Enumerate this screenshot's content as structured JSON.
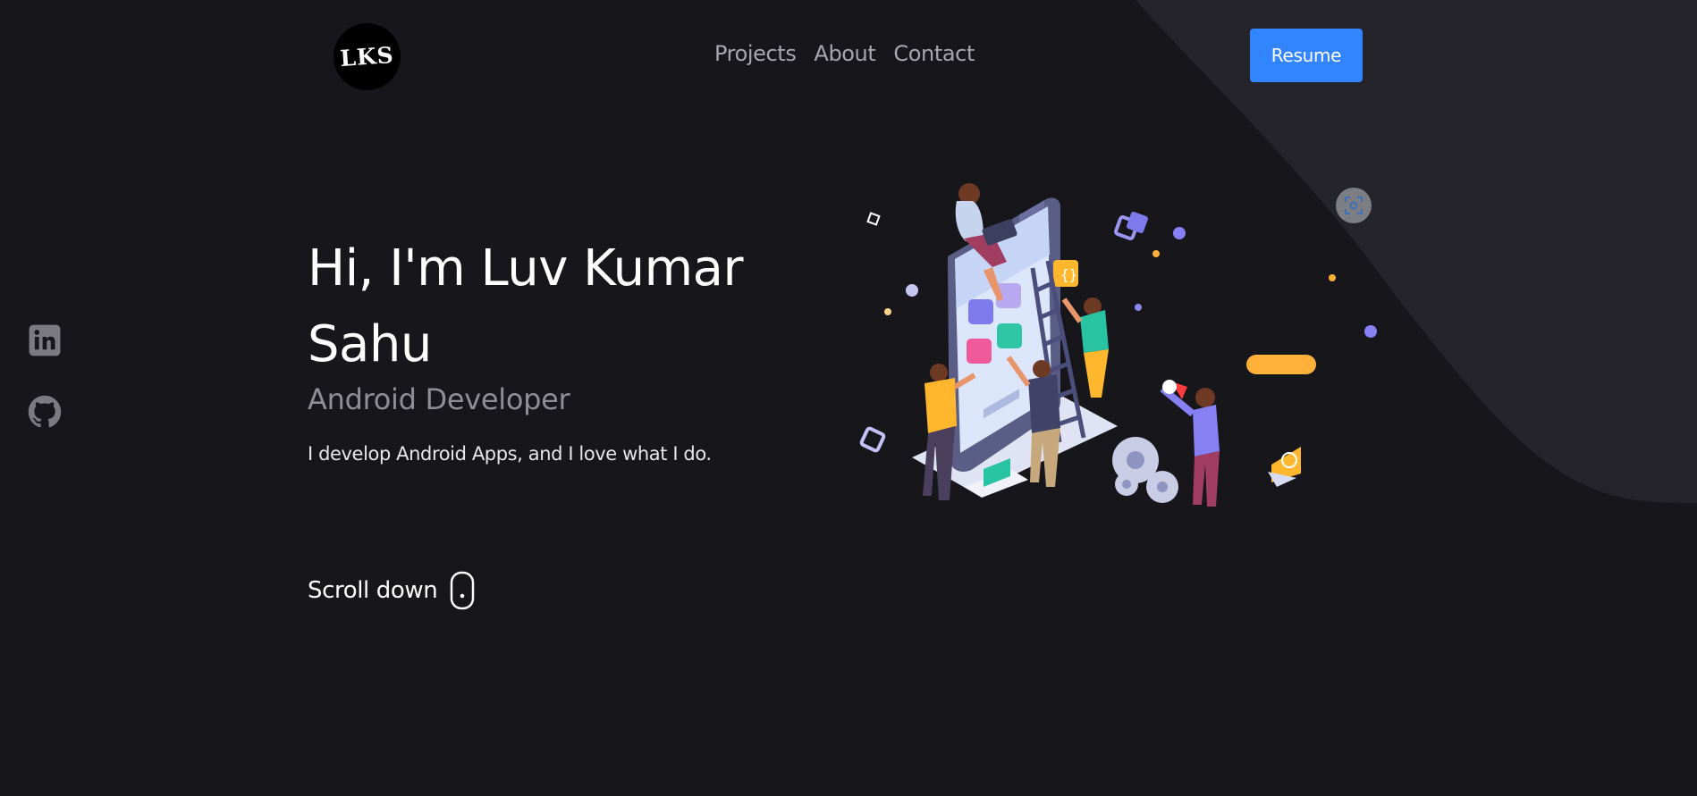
{
  "header": {
    "logo_text": "LKS",
    "nav": [
      {
        "label": "Projects"
      },
      {
        "label": "About"
      },
      {
        "label": "Contact"
      }
    ],
    "resume_label": "Resume"
  },
  "socials": [
    {
      "name": "linkedin-icon"
    },
    {
      "name": "github-icon"
    }
  ],
  "hero": {
    "title": "Hi, I'm Luv Kumar Sahu",
    "role": "Android Developer",
    "description": "I develop Android Apps, and I love what I do.",
    "scroll_label": "Scroll down"
  },
  "colors": {
    "background": "#16161b",
    "shape": "#24242a",
    "accent": "#3385ff",
    "muted_text": "#8e8e95",
    "nav_text": "#a6a6ad"
  },
  "icons": {
    "scroll": "mouse-icon",
    "floating_action": "screenshot-scan-icon"
  }
}
